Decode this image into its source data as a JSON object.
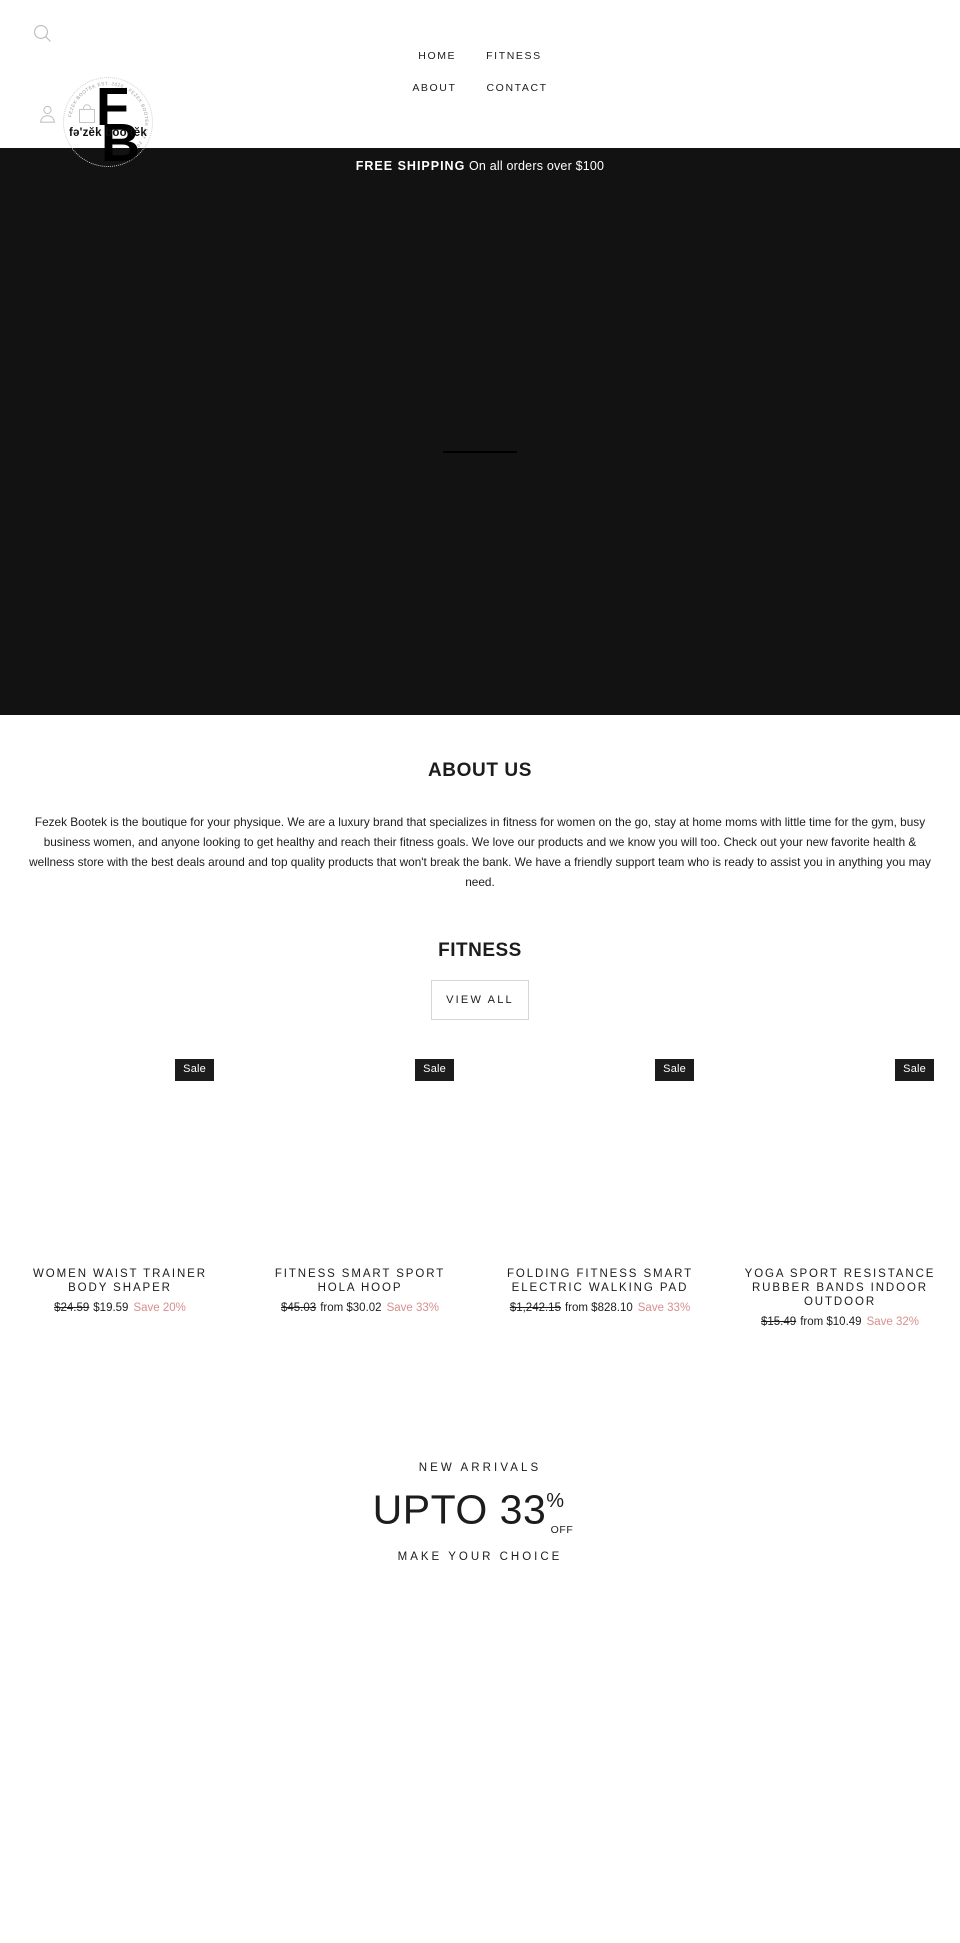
{
  "header": {
    "search_icon": "search-icon",
    "account_icon": "account-person-icon",
    "cart_icon": "shopping-bag-icon",
    "logo": {
      "letter_top": "F",
      "letter_bottom": "B",
      "wordmark": "fə'zĕk boo'tĕk",
      "ring_text": "FEZEK BOOTEK EST. 2020 • FEZEK BOOTEK EST. 2020 •"
    },
    "nav": [
      {
        "label": "HOME"
      },
      {
        "label": "FITNESS"
      },
      {
        "label": "ABOUT"
      },
      {
        "label": "CONTACT"
      }
    ]
  },
  "announcement": {
    "strong": "FREE SHIPPING",
    "rest": " On all orders over $100"
  },
  "hero": {
    "title": "",
    "subtitle": ""
  },
  "about": {
    "title": "ABOUT US",
    "body": "Fezek Bootek is the boutique for your physique. We are a luxury brand that specializes in fitness for women on the go, stay at home moms with little time for the gym, busy business women, and anyone looking to get healthy and reach their fitness goals. We love our products and we know you will too. Check out your new favorite health & wellness store with the best deals around and top quality products that won't break the bank. We have a friendly support team who is ready to assist you in anything you may need."
  },
  "collection": {
    "title": "FITNESS",
    "view_all_label": "VIEW ALL"
  },
  "products": [
    {
      "badge": "Sale",
      "title": "WOMEN WAIST TRAINER BODY SHAPER",
      "compare_price": "$24.59",
      "price": "$19.59",
      "save": "Save 20%"
    },
    {
      "badge": "Sale",
      "title": "FITNESS SMART SPORT HOLA HOOP",
      "compare_price": "$45.03",
      "price": "from $30.02",
      "save": "Save 33%"
    },
    {
      "badge": "Sale",
      "title": "FOLDING FITNESS SMART ELECTRIC WALKING PAD",
      "compare_price": "$1,242.15",
      "price": "from $828.10",
      "save": "Save 33%"
    },
    {
      "badge": "Sale",
      "title": "YOGA SPORT RESISTANCE RUBBER BANDS INDOOR OUTDOOR",
      "compare_price": "$15.49",
      "price": "from $10.49",
      "save": "Save 32%"
    }
  ],
  "promo": {
    "kicker": "NEW ARRIVALS",
    "headline_main": "UPTO 33",
    "headline_pct": "%",
    "headline_off": "OFF",
    "subtitle": "MAKE YOUR CHOICE"
  },
  "colors": {
    "ink": "#1c1c1c",
    "dark_panel": "#121212",
    "sale_text": "#d98e8e",
    "page_bg": "#ffffff",
    "border": "#d6d6d6"
  }
}
